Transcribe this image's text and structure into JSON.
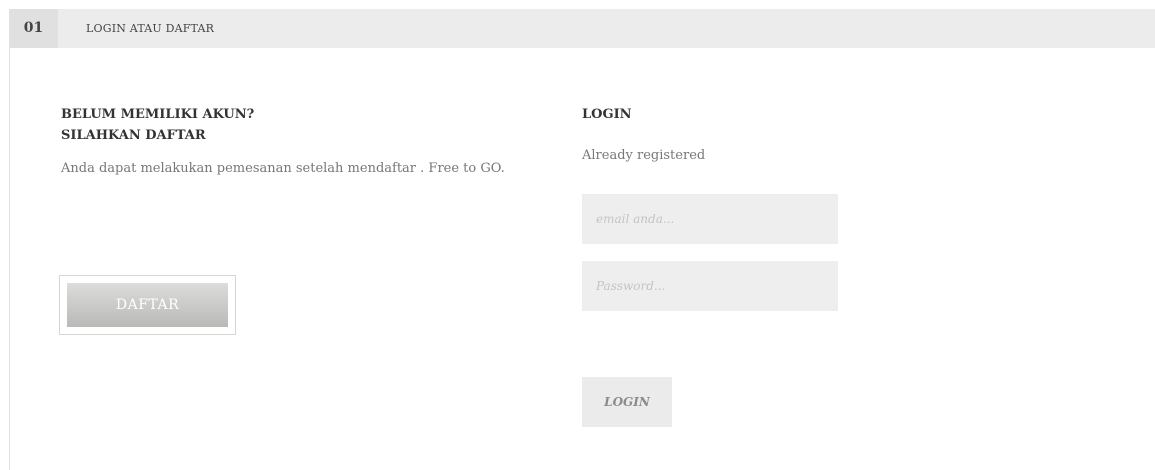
{
  "step": {
    "number": "01",
    "title": "LOGIN ATAU DAFTAR"
  },
  "register": {
    "heading_line1": "BELUM MEMILIKI AKUN?",
    "heading_line2": "SILAHKAN DAFTAR",
    "text": "Anda dapat melakukan pemesanan setelah mendaftar . Free to GO.",
    "button_label": "DAFTAR"
  },
  "login": {
    "heading": "LOGIN",
    "subtitle": "Already registered",
    "email_placeholder": "email anda...",
    "password_placeholder": "Password...",
    "button_label": "LOGIN"
  },
  "colors": {
    "header_bg": "#ececec",
    "step_number_bg": "#e0e0e0",
    "field_bg": "#eeeeee",
    "daftar_button": "#c9c9c7"
  }
}
